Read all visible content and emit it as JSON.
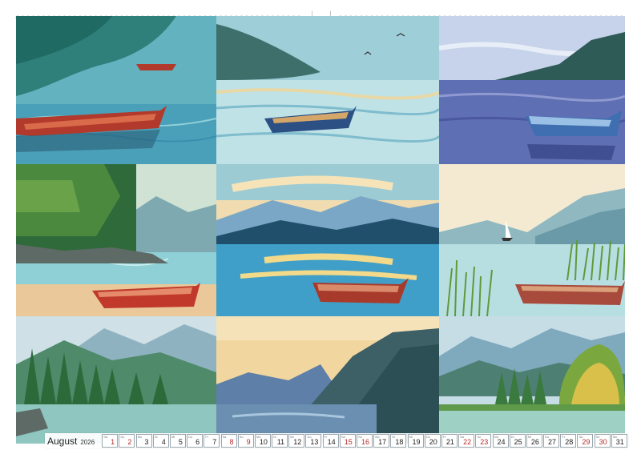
{
  "calendar": {
    "month": "August",
    "year": "2026",
    "days": [
      {
        "n": "1",
        "wd": "Sa",
        "weekend": true
      },
      {
        "n": "2",
        "wd": "So",
        "weekend": true
      },
      {
        "n": "3",
        "wd": "Mo",
        "weekend": false
      },
      {
        "n": "4",
        "wd": "Di",
        "weekend": false
      },
      {
        "n": "5",
        "wd": "Mi",
        "weekend": false
      },
      {
        "n": "6",
        "wd": "Do",
        "weekend": false
      },
      {
        "n": "7",
        "wd": "Fr",
        "weekend": false
      },
      {
        "n": "8",
        "wd": "Sa",
        "weekend": true
      },
      {
        "n": "9",
        "wd": "So",
        "weekend": true
      },
      {
        "n": "10",
        "wd": "Mo",
        "weekend": false
      },
      {
        "n": "11",
        "wd": "Di",
        "weekend": false
      },
      {
        "n": "12",
        "wd": "Mi",
        "weekend": false
      },
      {
        "n": "13",
        "wd": "Do",
        "weekend": false
      },
      {
        "n": "14",
        "wd": "Fr",
        "weekend": false
      },
      {
        "n": "15",
        "wd": "Sa",
        "weekend": true
      },
      {
        "n": "16",
        "wd": "So",
        "weekend": true
      },
      {
        "n": "17",
        "wd": "Mo",
        "weekend": false
      },
      {
        "n": "18",
        "wd": "Di",
        "weekend": false
      },
      {
        "n": "19",
        "wd": "Mi",
        "weekend": false
      },
      {
        "n": "20",
        "wd": "Do",
        "weekend": false
      },
      {
        "n": "21",
        "wd": "Fr",
        "weekend": false
      },
      {
        "n": "22",
        "wd": "Sa",
        "weekend": true
      },
      {
        "n": "23",
        "wd": "So",
        "weekend": true
      },
      {
        "n": "24",
        "wd": "Mo",
        "weekend": false
      },
      {
        "n": "25",
        "wd": "Di",
        "weekend": false
      },
      {
        "n": "26",
        "wd": "Mi",
        "weekend": false
      },
      {
        "n": "27",
        "wd": "Do",
        "weekend": false
      },
      {
        "n": "28",
        "wd": "Fr",
        "weekend": false
      },
      {
        "n": "29",
        "wd": "Sa",
        "weekend": true
      },
      {
        "n": "30",
        "wd": "So",
        "weekend": true
      },
      {
        "n": "31",
        "wd": "Mo",
        "weekend": false
      }
    ]
  },
  "colors": {
    "weekend_text": "#b52a2a",
    "day_border": "#9aa6ad",
    "binding": "#aeb4b8"
  },
  "illustrations": [
    {
      "name": "red-rowboat-teal-water",
      "sky": "#7fc7c4",
      "water": "#5fb0c0",
      "boat": "#b23a2c"
    },
    {
      "name": "blue-rowboat-calm-lake-birds",
      "sky": "#a9d6de",
      "water": "#bfe2e6",
      "boat": "#2c4f84"
    },
    {
      "name": "blue-boat-purple-lake",
      "sky": "#c6d3ea",
      "water": "#5f6fb3",
      "boat": "#3f6fb0"
    },
    {
      "name": "red-boat-forest-shore",
      "sky": "#cfe2d4",
      "water": "#9fd0d6",
      "boat": "#c0392b"
    },
    {
      "name": "red-boat-sunset-lake",
      "sky": "#f0dcb0",
      "water": "#3f9fc8",
      "boat": "#a83a2c"
    },
    {
      "name": "sailboat-reeds-lake",
      "sky": "#f4ead2",
      "water": "#b7dfe2",
      "boat": "#a84a3c"
    },
    {
      "name": "forest-mountain-valley",
      "sky": "#cfe0e6",
      "water": "#8fc6c0",
      "boat": ""
    },
    {
      "name": "mountain-lake-sunset",
      "sky": "#f2d6a0",
      "water": "#6a8fb0",
      "boat": ""
    },
    {
      "name": "autumn-forest-lake",
      "sky": "#c7dde6",
      "water": "#9fd0c4",
      "boat": ""
    }
  ]
}
